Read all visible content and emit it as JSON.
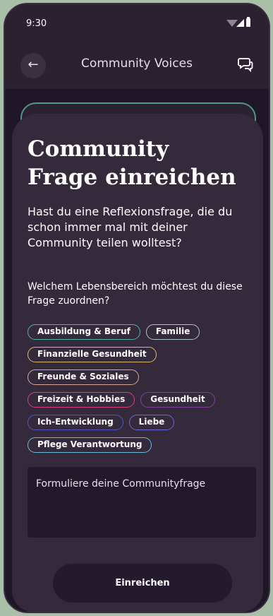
{
  "status": {
    "time": "9:30"
  },
  "appbar": {
    "title": "Community Voices",
    "back_icon": "arrow-left-icon",
    "action_icon": "chat-bubbles-icon"
  },
  "sheet": {
    "title_line1": "Community",
    "title_line2": "Frage einreichen",
    "subtitle": "Hast du eine Reflexionsfrage, die du schon immer mal mit deiner Community teilen wolltest?",
    "question": "Welchem Lebensbereich möchtest du diese Frage zuordnen?",
    "chips": [
      {
        "label": "Ausbildung & Beruf",
        "color": "#4fb59a"
      },
      {
        "label": "Familie",
        "color": "#a9c7c4"
      },
      {
        "label": "Finanzielle Gesundheit",
        "color": "#d9b866"
      },
      {
        "label": "Freunde & Soziales",
        "color": "#d8a799"
      },
      {
        "label": "Freizeit & Hobbies",
        "color": "#d6407c"
      },
      {
        "label": "Gesundheit",
        "color": "#7d3f9a"
      },
      {
        "label": "Ich-Entwicklung",
        "color": "#4f55c9"
      },
      {
        "label": "Liebe",
        "color": "#6a67d8"
      },
      {
        "label": "Pflege Verantwortung",
        "color": "#6bb8d8"
      }
    ],
    "input_placeholder": "Formuliere deine Communityfrage",
    "submit_label": "Einreichen"
  }
}
